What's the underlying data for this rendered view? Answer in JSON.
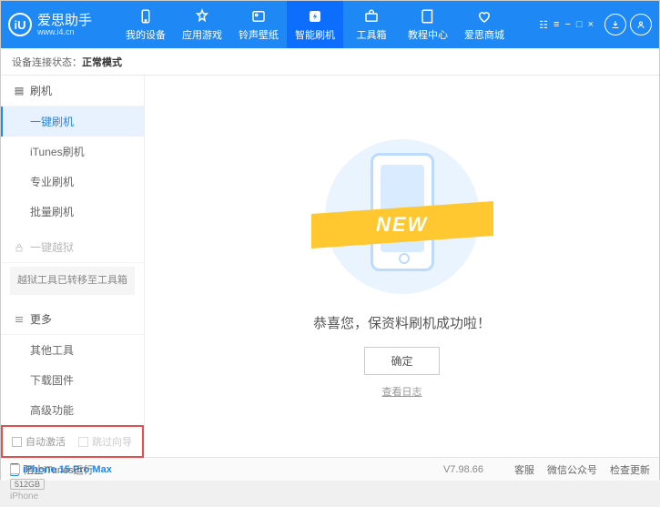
{
  "logo": {
    "icon_text": "iU",
    "title": "爱思助手",
    "sub": "www.i4.cn"
  },
  "nav": [
    {
      "label": "我的设备"
    },
    {
      "label": "应用游戏"
    },
    {
      "label": "铃声壁纸"
    },
    {
      "label": "智能刷机",
      "active": true
    },
    {
      "label": "工具箱"
    },
    {
      "label": "教程中心"
    },
    {
      "label": "爱思商城"
    }
  ],
  "status": {
    "label": "设备连接状态：",
    "value": "正常模式"
  },
  "sidebar": {
    "s1_title": "刷机",
    "items1": [
      "一键刷机",
      "iTunes刷机",
      "专业刷机",
      "批量刷机"
    ],
    "s2_title": "一键越狱",
    "note": "越狱工具已转移至工具箱",
    "s3_title": "更多",
    "items3": [
      "其他工具",
      "下载固件",
      "高级功能"
    ],
    "checks": {
      "a": "自动激活",
      "b": "跳过向导"
    },
    "device": {
      "name": "iPhone 15 Pro Max",
      "storage": "512GB",
      "type": "iPhone"
    }
  },
  "main": {
    "banner": "NEW",
    "message": "恭喜您，保资料刷机成功啦！",
    "ok": "确定",
    "log": "查看日志"
  },
  "footer": {
    "block": "阻止iTunes运行",
    "version": "V7.98.66",
    "links": [
      "客服",
      "微信公众号",
      "检查更新"
    ]
  }
}
